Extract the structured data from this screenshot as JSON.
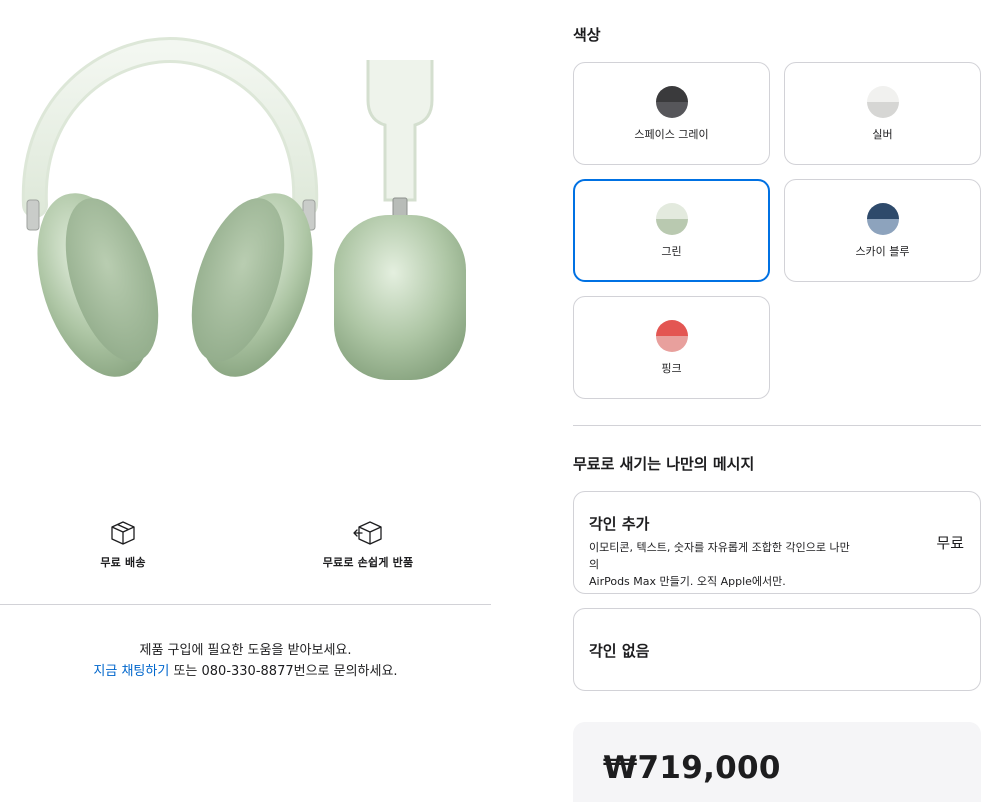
{
  "colors": {
    "title": "색상",
    "options": [
      {
        "label": "스페이스 그레이",
        "top": "#3a3a3c",
        "bottom": "#56565a",
        "selected": false
      },
      {
        "label": "실버",
        "top": "#f1f1ef",
        "bottom": "#d6d6d4",
        "selected": false
      },
      {
        "label": "그린",
        "top": "#e3eade",
        "bottom": "#b9c9b0",
        "selected": true
      },
      {
        "label": "스카이 블루",
        "top": "#2e4a6b",
        "bottom": "#8da3bd",
        "selected": false
      },
      {
        "label": "핑크",
        "top": "#e35652",
        "bottom": "#e8a09d",
        "selected": false
      }
    ]
  },
  "engraving": {
    "title": "무료로 새기는 나만의 메시지",
    "add": {
      "title": "각인 추가",
      "desc_line1": "이모티콘, 텍스트, 숫자를 자유롭게 조합한 각인으로 나만의",
      "desc_line2": "AirPods Max 만들기. 오직 Apple에서만.",
      "price": "무료"
    },
    "none": {
      "title": "각인 없음"
    }
  },
  "price": "₩719,000",
  "features": {
    "delivery": "무료 배송",
    "returns": "무료로 손쉽게 반품"
  },
  "help": {
    "line1": "제품 구입에 필요한 도움을 받아보세요.",
    "chat_link": "지금 채팅하기",
    "line2_rest": " 또는 080-330-8877번으로 문의하세요."
  },
  "accent": "#0071e3",
  "link_color": "#0066cc"
}
